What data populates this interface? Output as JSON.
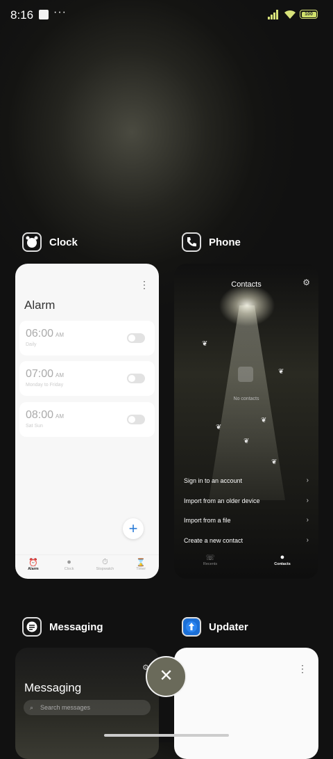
{
  "status_bar": {
    "time": "8:16",
    "battery": "100"
  },
  "cards": {
    "clock": {
      "app_name": "Clock",
      "screen_title": "Alarm",
      "alarms": [
        {
          "time": "06:00",
          "ampm": "AM",
          "repeat": "Daily"
        },
        {
          "time": "07:00",
          "ampm": "AM",
          "repeat": "Monday to Friday"
        },
        {
          "time": "08:00",
          "ampm": "AM",
          "repeat": "Sat Sun"
        }
      ],
      "fab_label": "+",
      "nav": [
        "Alarm",
        "Clock",
        "Stopwatch",
        "Timer"
      ]
    },
    "phone": {
      "app_name": "Phone",
      "screen_title": "Contacts",
      "empty_text": "No contacts",
      "options": [
        "Sign in to an account",
        "Import from an older device",
        "Import from a file",
        "Create a new contact"
      ],
      "nav": [
        "Recents",
        "Contacts"
      ]
    },
    "messaging": {
      "app_name": "Messaging",
      "screen_title": "Messaging",
      "search_placeholder": "Search messages"
    },
    "updater": {
      "app_name": "Updater"
    }
  },
  "close_button_label": "✕"
}
